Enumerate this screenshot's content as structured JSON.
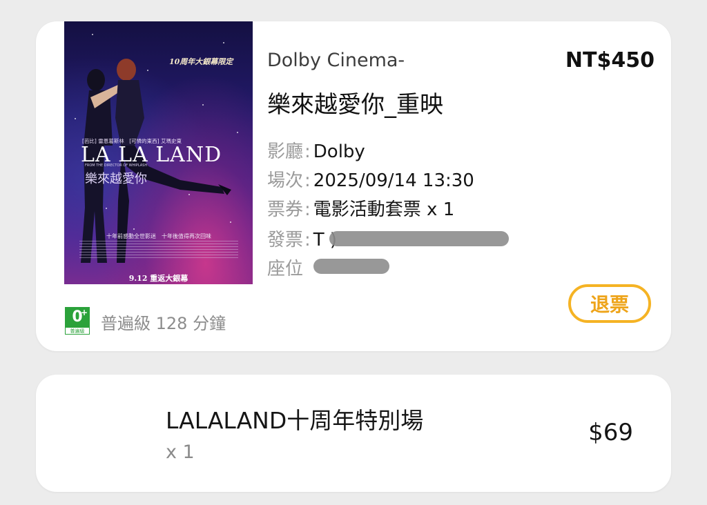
{
  "ticket": {
    "poster": {
      "anniversary": "10周年大銀幕限定",
      "cast": "[芭比] 雷恩葛斯林　[可憐的東西] 艾瑪史東",
      "title": "LA LA LAND",
      "director_line": "FROM THE DIRECTOR OF WHIPLASH",
      "title_zh": "樂來越愛你",
      "tagline": "十年前感動全世影迷　十年後值得再次回味",
      "release_date": "9.12 重返大銀幕"
    },
    "cinema": "Dolby Cinema-",
    "price": "NT$450",
    "movie_title": "樂來越愛你_重映",
    "details": [
      {
        "label": "影廳",
        "separator": ":",
        "value": "Dolby"
      },
      {
        "label": "場次",
        "separator": ":",
        "value": "2025/09/14 13:30"
      },
      {
        "label": "票券",
        "separator": ":",
        "value": "電影活動套票 x 1"
      },
      {
        "label": "發票",
        "separator": ":",
        "value": "T                    )"
      },
      {
        "label": "座位",
        "separator": "",
        "value": ""
      }
    ],
    "refund_label": "退票",
    "rating": {
      "badge_number": "0",
      "badge_plus": "+",
      "badge_text": "普遍級",
      "text": "普遍級 128 分鐘",
      "color": "#2ba23a"
    },
    "accent_color": "#f5b324"
  },
  "addon": {
    "name": "LALALAND十周年特別場",
    "quantity": "x 1",
    "price": "$69"
  }
}
